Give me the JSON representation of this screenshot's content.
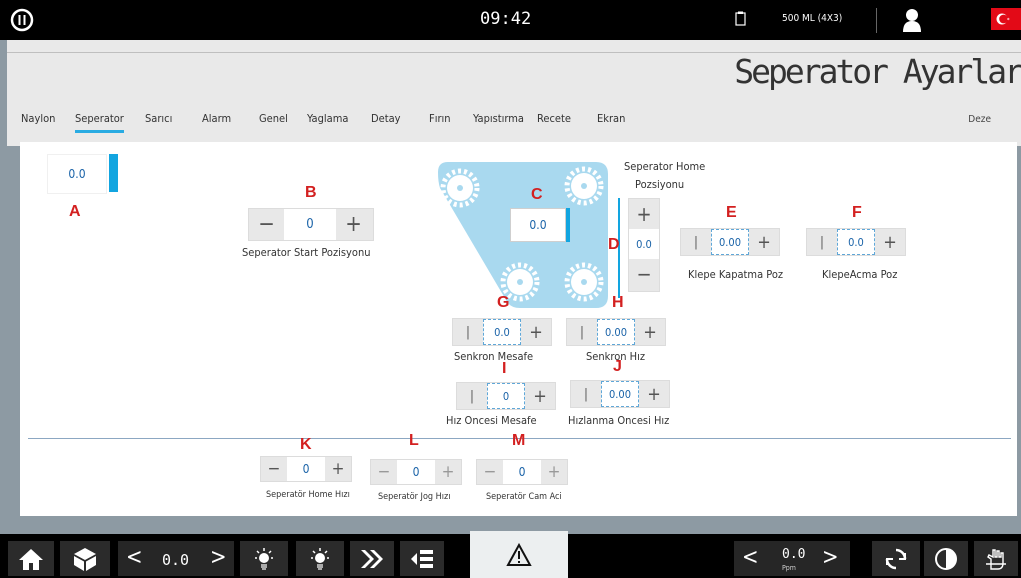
{
  "status": {
    "time": "09:42",
    "volume": "500 ML  (4X3)"
  },
  "header": {
    "title": "Seperator Ayarlar"
  },
  "tabs": [
    "Naylon",
    "Seperator",
    "Sarıcı",
    "Alarm",
    "Genel",
    "Yaglama",
    "Detay",
    "Fırın",
    "Yapıstırma",
    "Recete",
    "Ekran"
  ],
  "tab_right": "Deze",
  "main": {
    "a": {
      "letter": "A",
      "value": "0.0"
    },
    "b": {
      "letter": "B",
      "value": "0",
      "label": "Seperator Start Pozisyonu"
    },
    "c": {
      "letter": "C",
      "value": "0.0"
    },
    "d": {
      "letter": "D",
      "value": "0.0",
      "label_line1": "Seperator Home",
      "label_line2": "Pozsiyonu"
    },
    "e": {
      "letter": "E",
      "value": "0.00",
      "label": "Klepe Kapatma Poz"
    },
    "f": {
      "letter": "F",
      "value": "0.0",
      "label": "KlepeAcma Poz"
    },
    "g": {
      "letter": "G",
      "value": "0.0",
      "label": "Senkron Mesafe"
    },
    "h": {
      "letter": "H",
      "value": "0.00",
      "label": "Senkron Hız"
    },
    "i": {
      "letter": "I",
      "value": "0",
      "label": "Hız Oncesi Mesafe"
    },
    "j": {
      "letter": "J",
      "value": "0.00",
      "label": "Hızlanma Oncesi Hız"
    },
    "k": {
      "letter": "K",
      "value": "0",
      "label": "Seperatör Home Hızı"
    },
    "l": {
      "letter": "L",
      "value": "0",
      "label": "Seperatör Jog Hızı"
    },
    "m": {
      "letter": "M",
      "value": "0",
      "label": "Seperatör Cam Aci"
    }
  },
  "bottom": {
    "speed_value": "0.0",
    "ppm_value": "0.0",
    "ppm_unit": "Ppm"
  },
  "colors": {
    "accent": "#12a5e0",
    "annotation": "#d32020",
    "machine": "#a9d9ef"
  }
}
